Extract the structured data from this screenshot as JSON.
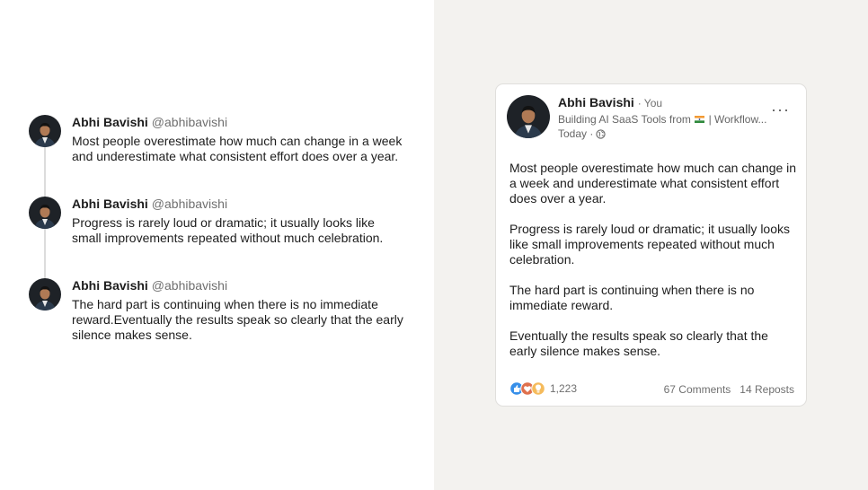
{
  "author": {
    "name": "Abhi Bavishi",
    "handle": "@abhibavishi"
  },
  "thread": [
    {
      "text": "Most people overestimate how much can change in a week and underestimate what consistent effort does over a year."
    },
    {
      "text": "Progress is rarely loud or dramatic; it usually looks like small improvements repeated without much celebration."
    },
    {
      "text": "The hard part is continuing when there is no immediate reward.Eventually the results speak so clearly that the early silence makes sense."
    }
  ],
  "post": {
    "name": "Abhi Bavishi",
    "you_label": "· You",
    "headline_before_flag": "Building AI SaaS Tools from",
    "headline_after_flag": "| Workflow...",
    "time": "Today ·",
    "paragraphs": [
      "Most people overestimate how much can change in a week and underestimate what consistent effort does over a year.",
      "Progress is rarely loud or dramatic; it usually looks like small improvements repeated without much celebration.",
      "The hard part is continuing when there is no immediate reward.",
      "Eventually the results speak so clearly that the early silence makes sense."
    ],
    "reaction_count": "1,223",
    "comments": "67 Comments",
    "reposts": "14 Reposts",
    "more_icon": "ellipsis-icon"
  },
  "colors": {
    "right_bg": "#f3f2ef",
    "text": "#1d1d1d",
    "muted": "#6f6f6f"
  }
}
